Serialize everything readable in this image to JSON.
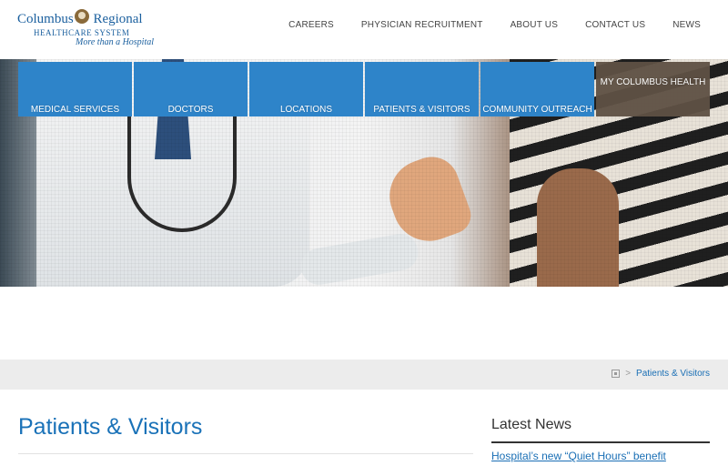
{
  "logo": {
    "word1": "Columbus",
    "word2": "Regional",
    "subtitle": "HEALTHCARE SYSTEM",
    "tagline": "More than a Hospital"
  },
  "topnav": [
    "CAREERS",
    "PHYSICIAN RECRUITMENT",
    "ABOUT US",
    "CONTACT US",
    "NEWS"
  ],
  "mega_nav": [
    {
      "label": "MEDICAL SERVICES"
    },
    {
      "label": "DOCTORS"
    },
    {
      "label": "LOCATIONS"
    },
    {
      "label": "PATIENTS & VISITORS"
    },
    {
      "label": "COMMUNITY OUTREACH"
    },
    {
      "label": "MY COLUMBUS HEALTH"
    }
  ],
  "breadcrumb": {
    "separator": ">",
    "current": "Patients & Visitors"
  },
  "page": {
    "title": "Patients & Visitors"
  },
  "news": {
    "heading": "Latest News",
    "first_item": "Hospital’s new “Quiet Hours” benefit"
  },
  "colors": {
    "brand_blue": "#1a72b8",
    "nav_blue": "#2e84c9",
    "nav_brown": "#5f5144"
  }
}
